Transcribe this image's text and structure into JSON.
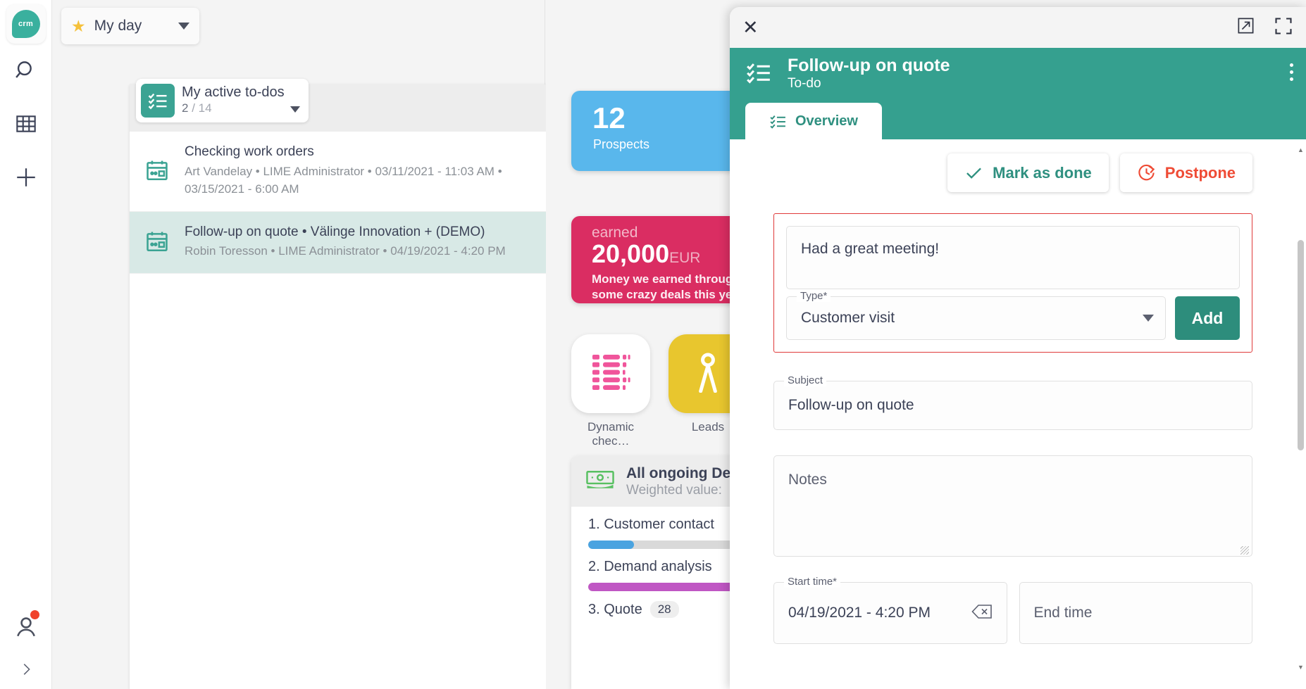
{
  "rail": {
    "logo_text": "crm",
    "icons": [
      {
        "name": "search-icon"
      },
      {
        "name": "grid-icon"
      },
      {
        "name": "plus-icon"
      }
    ],
    "user_icon": "person-icon",
    "expand_icon": "chevron-right-icon"
  },
  "topbar": {
    "myday_label": "My day",
    "star_icon": "star-icon",
    "caret_icon": "chevron-down-icon"
  },
  "todo_panel": {
    "title": "My active to-dos",
    "count_done": "2",
    "count_sep": "/",
    "count_total": "14",
    "expand_icon": "expand-icon",
    "items": [
      {
        "title": "Checking work orders",
        "meta": "Art Vandelay • LIME Administrator • 03/11/2021 - 11:03 AM • 03/15/2021 - 6:00 AM",
        "selected": false
      },
      {
        "title": "Follow-up on quote • Välinge Innovation + (DEMO)",
        "meta": "Robin Toresson • LIME Administrator • 04/19/2021 - 4:20 PM",
        "selected": true
      }
    ]
  },
  "dashboard": {
    "kpi_prospects": {
      "value": "12",
      "label": "Prospects",
      "color": "#59b7ec"
    },
    "kpi_earned": {
      "eyebrow": "earned",
      "value": "20,000",
      "currency": "EUR",
      "description": "Money we earned through some crazy deals this year",
      "color": "#da2d62"
    },
    "tiles": [
      {
        "caption": "Dynamic chec…",
        "icon": "list-icon",
        "color": "#f0559b"
      },
      {
        "caption": "Leads",
        "icon": "leads-icon",
        "color": "#e8c62e"
      }
    ],
    "funnel": {
      "title": "All ongoing Deals",
      "subtitle": "Weighted value:",
      "icon": "money-icon"
    },
    "chart_data": {
      "type": "bar",
      "title": "All ongoing Deals",
      "categories": [
        "1. Customer contact",
        "2. Demand analysis",
        "3. Quote"
      ],
      "values": [
        17,
        95,
        28
      ],
      "badges": [
        "",
        "",
        "28"
      ],
      "colors": [
        "#4aa3e0",
        "#c057c4",
        "#d9d9d9"
      ],
      "xlabel": "",
      "ylabel": "",
      "ylim": [
        0,
        100
      ]
    }
  },
  "dialog": {
    "close_icon": "close-icon",
    "popout_icon": "open-in-new-icon",
    "fullscreen_icon": "fullscreen-icon",
    "header": {
      "icon": "checklist-icon",
      "title": "Follow-up on quote",
      "subtitle": "To-do",
      "menu_icon": "kebab-menu-icon"
    },
    "tabs": [
      {
        "label": "Overview",
        "icon": "checklist-icon",
        "active": true
      }
    ],
    "actions": {
      "mark_done": "Mark as done",
      "mark_done_icon": "check-icon",
      "postpone": "Postpone",
      "postpone_icon": "clock-rotate-icon",
      "postpone_color": "#ef4b35",
      "mark_done_color": "#2f9080"
    },
    "comment": {
      "text": "Had a great meeting!",
      "type_label": "Type*",
      "type_value": "Customer visit",
      "add_label": "Add",
      "highlight_color": "#e03a3a"
    },
    "subject": {
      "label": "Subject",
      "value": "Follow-up on quote"
    },
    "notes": {
      "placeholder": "Notes"
    },
    "start_time": {
      "label": "Start time*",
      "value": "04/19/2021 - 4:20 PM",
      "clear_icon": "backspace-icon"
    },
    "end_time": {
      "placeholder": "End time"
    }
  }
}
